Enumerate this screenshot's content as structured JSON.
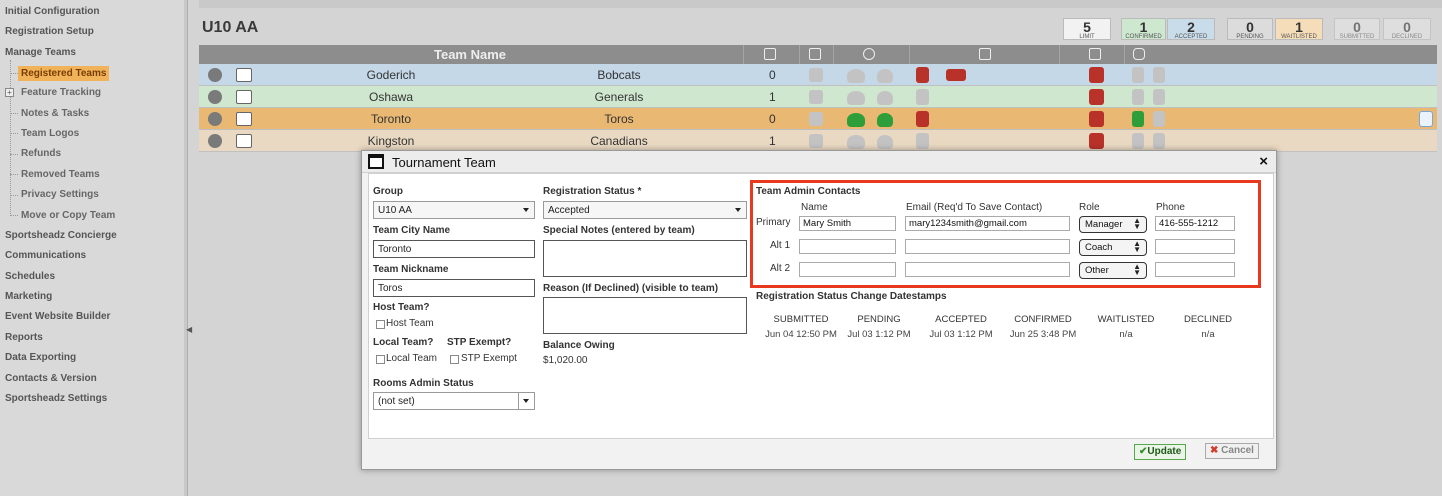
{
  "sidebar": {
    "items": [
      {
        "label": "Initial Configuration"
      },
      {
        "label": "Registration Setup"
      },
      {
        "label": "Manage Teams"
      },
      {
        "label": "Sportsheadz Concierge"
      },
      {
        "label": "Communications"
      },
      {
        "label": "Schedules"
      },
      {
        "label": "Marketing"
      },
      {
        "label": "Event Website Builder"
      },
      {
        "label": "Reports"
      },
      {
        "label": "Data Exporting"
      },
      {
        "label": "Contacts & Version"
      },
      {
        "label": "Sportsheadz Settings"
      }
    ],
    "subitems": [
      {
        "label": "Registered Teams",
        "active": true
      },
      {
        "label": "Feature Tracking"
      },
      {
        "label": "Notes & Tasks"
      },
      {
        "label": "Team Logos"
      },
      {
        "label": "Refunds"
      },
      {
        "label": "Removed Teams"
      },
      {
        "label": "Privacy Settings"
      },
      {
        "label": "Move or Copy Team"
      }
    ]
  },
  "division": {
    "title": "U10 AA",
    "stats": [
      {
        "num": "5",
        "label": "LIMIT",
        "color": "#f2f2f2"
      },
      {
        "num": "1",
        "label": "CONFIRMED",
        "color": "#cde8cf"
      },
      {
        "num": "2",
        "label": "ACCEPTED",
        "color": "#c8dcea"
      },
      {
        "num": "0",
        "label": "PENDING",
        "color": "#dcdcdc"
      },
      {
        "num": "1",
        "label": "WAITLISTED",
        "color": "#f4ddb8"
      },
      {
        "num": "0",
        "label": "SUBMITTED",
        "color": "#e6e6e6"
      },
      {
        "num": "0",
        "label": "DECLINED",
        "color": "#e6e6e6"
      }
    ]
  },
  "grid": {
    "header": {
      "team_name": "Team Name"
    },
    "rows": [
      {
        "city": "Goderich",
        "nickname": "Bobcats",
        "count": "0",
        "color": "#c5d8e8"
      },
      {
        "city": "Oshawa",
        "nickname": "Generals",
        "count": "1",
        "color": "#cfe6cf"
      },
      {
        "city": "Toronto",
        "nickname": "Toros",
        "count": "0",
        "color": "#e9b872"
      },
      {
        "city": "Kingston",
        "nickname": "Canadians",
        "count": "1",
        "color": "#e9d9c2"
      }
    ]
  },
  "modal": {
    "title": "Tournament Team",
    "close": "×",
    "group": {
      "label": "Group",
      "value": "U10 AA"
    },
    "team_city": {
      "label": "Team City Name",
      "value": "Toronto"
    },
    "team_nickname": {
      "label": "Team Nickname",
      "value": "Toros"
    },
    "host_team": {
      "label": "Host Team?",
      "check_label": "Host Team"
    },
    "local_team": {
      "label": "Local Team?",
      "check_label": "Local Team"
    },
    "stp_exempt": {
      "label": "STP Exempt?",
      "check_label": "STP Exempt"
    },
    "rooms_admin": {
      "label": "Rooms Admin Status",
      "value": "(not set)"
    },
    "registration_status": {
      "label": "Registration Status *",
      "value": "Accepted"
    },
    "special_notes": {
      "label": "Special Notes (entered by team)"
    },
    "reason_declined": {
      "label": "Reason (If Declined) (visible to team)"
    },
    "balance": {
      "label": "Balance Owing",
      "value": "$1,020.00"
    },
    "contacts": {
      "title": "Team Admin Contacts",
      "col_name": "Name",
      "col_email": "Email (Req'd To Save Contact)",
      "col_role": "Role",
      "col_phone": "Phone",
      "rows": [
        {
          "label": "Primary",
          "name": "Mary Smith",
          "email": "mary1234smith@gmail.com",
          "role": "Manager",
          "phone": "416-555-1212"
        },
        {
          "label": "Alt 1",
          "name": "",
          "email": "",
          "role": "Coach",
          "phone": ""
        },
        {
          "label": "Alt 2",
          "name": "",
          "email": "",
          "role": "Other",
          "phone": ""
        }
      ]
    },
    "datestamps": {
      "title": "Registration Status Change Datestamps",
      "columns": [
        {
          "head": "SUBMITTED",
          "value": "Jun 04 12:50 PM"
        },
        {
          "head": "PENDING",
          "value": "Jul 03 1:12 PM"
        },
        {
          "head": "ACCEPTED",
          "value": "Jul 03 1:12 PM"
        },
        {
          "head": "CONFIRMED",
          "value": "Jun 25 3:48 PM"
        },
        {
          "head": "WAITLISTED",
          "value": "n/a"
        },
        {
          "head": "DECLINED",
          "value": "n/a"
        }
      ]
    },
    "update_label": "Update",
    "cancel_label": "Cancel"
  }
}
